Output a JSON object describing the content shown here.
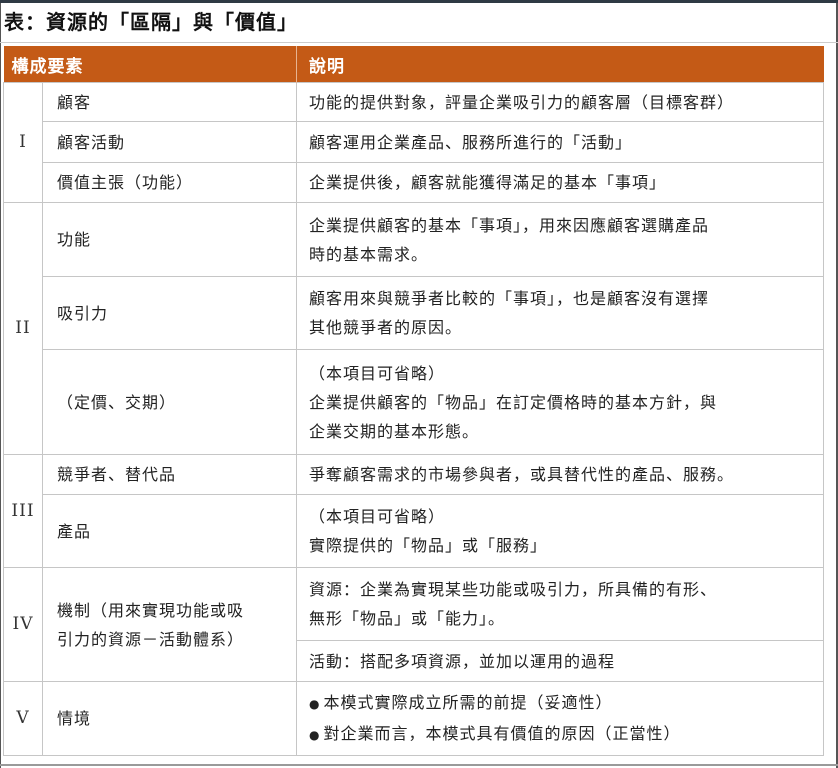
{
  "title": "表：資源的「區隔」與「價值」",
  "header": {
    "col_element": "構成要素",
    "col_desc": "說明"
  },
  "groups": [
    {
      "roman": "I",
      "rows": [
        {
          "name": "顧客",
          "desc": [
            "功能的提供對象，評量企業吸引力的顧客層（目標客群）"
          ]
        },
        {
          "name": "顧客活動",
          "desc": [
            "顧客運用企業產品、服務所進行的「活動」"
          ]
        },
        {
          "name": "價值主張（功能）",
          "desc": [
            "企業提供後，顧客就能獲得滿足的基本「事項」"
          ]
        }
      ]
    },
    {
      "roman": "II",
      "rows": [
        {
          "name": "功能",
          "desc": [
            "企業提供顧客的基本「事項」，用來因應顧客選購產品",
            "時的基本需求。"
          ]
        },
        {
          "name": "吸引力",
          "desc": [
            "顧客用來與競爭者比較的「事項」，也是顧客沒有選擇",
            "其他競爭者的原因。"
          ]
        },
        {
          "name": "（定價、交期）",
          "desc": [
            "（本項目可省略）",
            "企業提供顧客的「物品」在訂定價格時的基本方針，與",
            "企業交期的基本形態。"
          ]
        }
      ]
    },
    {
      "roman": "III",
      "rows": [
        {
          "name": "競爭者、替代品",
          "desc": [
            "爭奪顧客需求的市場參與者，或具替代性的產品、服務。"
          ]
        },
        {
          "name": "產品",
          "desc": [
            "（本項目可省略）",
            "實際提供的「物品」或「服務」"
          ]
        }
      ]
    },
    {
      "roman": "IV",
      "name": [
        "機制（用來實現功能或吸",
        "引力的資源－活動體系）"
      ],
      "desc_a": [
        "資源：企業為實現某些功能或吸引力，所具備的有形、",
        "無形「物品」或「能力」。"
      ],
      "desc_b": [
        "活動：搭配多項資源，並加以運用的過程"
      ]
    },
    {
      "roman": "V",
      "name": "情境",
      "bullet": "●",
      "bullets": [
        "本模式實際成立所需的前提（妥適性）",
        "對企業而言，本模式具有價值的原因（正當性）"
      ]
    }
  ]
}
